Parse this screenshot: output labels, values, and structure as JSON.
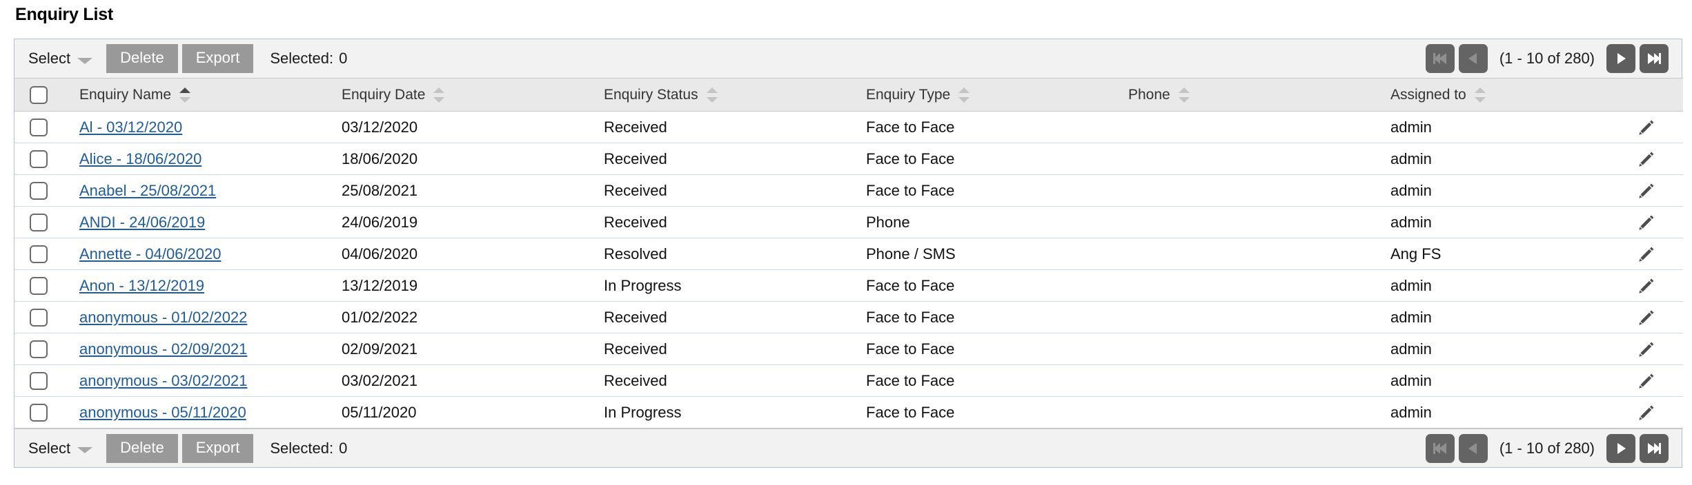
{
  "page_title": "Enquiry List",
  "toolbar": {
    "select_label": "Select",
    "delete_label": "Delete",
    "export_label": "Export",
    "selected_label": "Selected:",
    "selected_count": "0",
    "caret_icon": "chevron-down-icon"
  },
  "pagination": {
    "range_label": "(1 - 10 of 280)",
    "first_icon": "skip-to-first-icon",
    "prev_icon": "previous-page-icon",
    "next_icon": "next-page-icon",
    "last_icon": "skip-to-last-icon",
    "first_enabled": false,
    "prev_enabled": false,
    "next_enabled": true,
    "last_enabled": true,
    "page_start": 1,
    "page_end": 10,
    "total": 280
  },
  "table": {
    "columns": [
      {
        "key": "check",
        "label": "",
        "sortable": false,
        "sorted": "none"
      },
      {
        "key": "name",
        "label": "Enquiry Name",
        "sortable": true,
        "sorted": "asc"
      },
      {
        "key": "date",
        "label": "Enquiry Date",
        "sortable": true,
        "sorted": "none"
      },
      {
        "key": "status",
        "label": "Enquiry Status",
        "sortable": true,
        "sorted": "none"
      },
      {
        "key": "type",
        "label": "Enquiry Type",
        "sortable": true,
        "sorted": "none"
      },
      {
        "key": "phone",
        "label": "Phone",
        "sortable": true,
        "sorted": "none"
      },
      {
        "key": "assign",
        "label": "Assigned to",
        "sortable": true,
        "sorted": "none"
      },
      {
        "key": "edit",
        "label": "",
        "sortable": false,
        "sorted": "none"
      }
    ],
    "select_all_checkbox": false,
    "edit_icon": "pencil-icon",
    "row_checkbox_icon": "checkbox-unchecked-icon",
    "rows": [
      {
        "checked": false,
        "name": "Al - 03/12/2020",
        "date": "03/12/2020",
        "status": "Received",
        "type": "Face to Face",
        "phone": "",
        "assign": "admin"
      },
      {
        "checked": false,
        "name": "Alice - 18/06/2020",
        "date": "18/06/2020",
        "status": "Received",
        "type": "Face to Face",
        "phone": "",
        "assign": "admin"
      },
      {
        "checked": false,
        "name": "Anabel - 25/08/2021",
        "date": "25/08/2021",
        "status": "Received",
        "type": "Face to Face",
        "phone": "",
        "assign": "admin"
      },
      {
        "checked": false,
        "name": "ANDI - 24/06/2019",
        "date": "24/06/2019",
        "status": "Received",
        "type": "Phone",
        "phone": "",
        "assign": "admin"
      },
      {
        "checked": false,
        "name": "Annette - 04/06/2020",
        "date": "04/06/2020",
        "status": "Resolved",
        "type": "Phone / SMS",
        "phone": "",
        "assign": "Ang FS"
      },
      {
        "checked": false,
        "name": "Anon - 13/12/2019",
        "date": "13/12/2019",
        "status": "In Progress",
        "type": "Face to Face",
        "phone": "",
        "assign": "admin"
      },
      {
        "checked": false,
        "name": "anonymous - 01/02/2022",
        "date": "01/02/2022",
        "status": "Received",
        "type": "Face to Face",
        "phone": "",
        "assign": "admin"
      },
      {
        "checked": false,
        "name": "anonymous - 02/09/2021",
        "date": "02/09/2021",
        "status": "Received",
        "type": "Face to Face",
        "phone": "",
        "assign": "admin"
      },
      {
        "checked": false,
        "name": "anonymous - 03/02/2021",
        "date": "03/02/2021",
        "status": "Received",
        "type": "Face to Face",
        "phone": "",
        "assign": "admin"
      },
      {
        "checked": false,
        "name": "anonymous - 05/11/2020",
        "date": "05/11/2020",
        "status": "In Progress",
        "type": "Face to Face",
        "phone": "",
        "assign": "admin"
      }
    ]
  },
  "colors": {
    "link": "#1f5c99",
    "button_grey": "#999999",
    "pager_button": "#5e5e5e",
    "header_bg": "#e9e9e9",
    "toolbar_bg": "#f2f2f2",
    "panel_border": "#aec3d8",
    "row_divider": "#ccd9e6"
  }
}
